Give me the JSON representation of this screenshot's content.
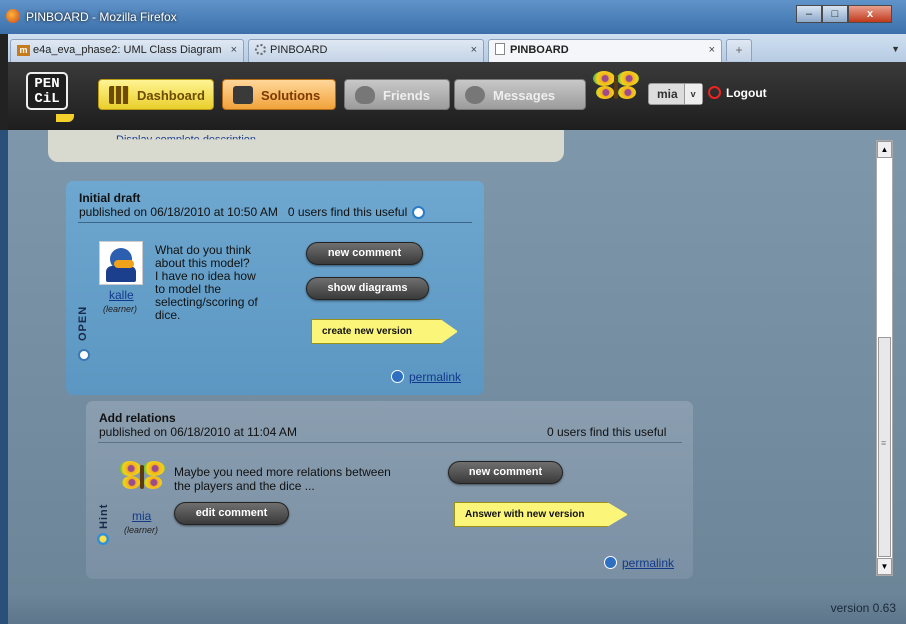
{
  "window": {
    "title": "PINBOARD - Mozilla Firefox",
    "minimize": "–",
    "maximize": "□",
    "close": "x"
  },
  "tabs": [
    {
      "label": "e4a_eva_phase2: UML Class Diagram",
      "close": "×"
    },
    {
      "label": "PINBOARD",
      "close": "×"
    },
    {
      "label": "PINBOARD",
      "close": "×"
    }
  ],
  "newtab": "+",
  "app": {
    "logo": "PEN CiL",
    "nav": {
      "dashboard": "Dashboard",
      "solutions": "Solutions",
      "friends": "Friends",
      "messages": "Messages"
    },
    "user": {
      "name": "mia",
      "dropdown": "v"
    },
    "logout": "Logout"
  },
  "top_card": {
    "link": "Display complete description"
  },
  "post1": {
    "title": "Initial draft",
    "published": "published on 06/18/2010 at 10:50 AM",
    "useful": "0 users find this useful",
    "author": "kalle",
    "role": "(learner)",
    "text": [
      "What do you think",
      "about this model?",
      "I have no idea how",
      "to model the",
      "selecting/scoring of",
      "dice."
    ],
    "status": "OPEN",
    "buttons": {
      "new_comment": "new comment",
      "show_diagrams": "show diagrams",
      "create_version": "create new version"
    },
    "permalink": "permalink"
  },
  "post2": {
    "title": "Add relations",
    "published": "published on 06/18/2010 at 11:04 AM",
    "useful": "0 users find this useful",
    "author": "mia",
    "role": "(learner)",
    "text": [
      "Maybe you need more relations between",
      "the players and the dice ..."
    ],
    "status": "Hint",
    "buttons": {
      "edit_comment": "edit comment",
      "new_comment": "new comment",
      "answer_version": "Answer with new version"
    },
    "permalink": "permalink"
  },
  "scroll": {
    "up": "▲",
    "down": "▼",
    "grip": "≡"
  },
  "footer": {
    "version": "version 0.63"
  }
}
